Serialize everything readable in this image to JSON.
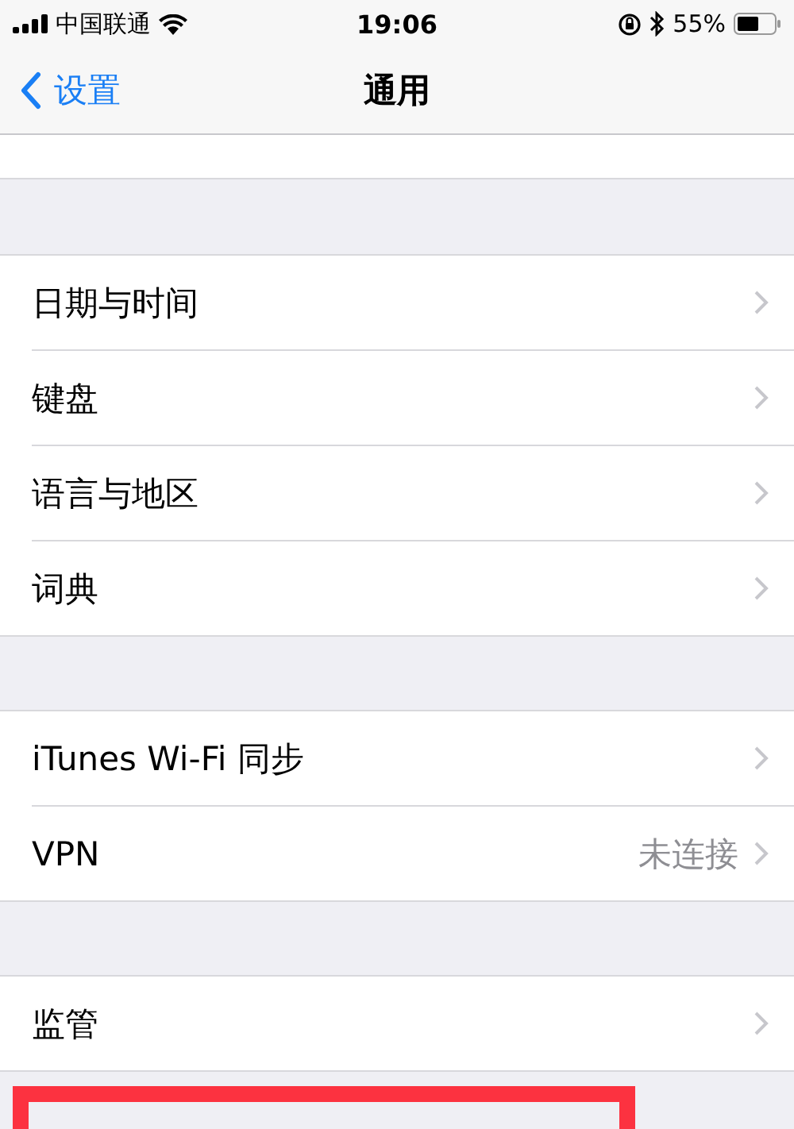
{
  "status_bar": {
    "carrier": "中国联通",
    "time": "19:06",
    "battery": "55%"
  },
  "nav": {
    "back": "设置",
    "title": "通用"
  },
  "groups": [
    {
      "rows": [
        {
          "label": "日期与时间"
        },
        {
          "label": "键盘"
        },
        {
          "label": "语言与地区"
        },
        {
          "label": "词典"
        }
      ]
    },
    {
      "rows": [
        {
          "label": "iTunes Wi-Fi 同步"
        },
        {
          "label": "VPN",
          "value": "未连接"
        }
      ]
    },
    {
      "rows": [
        {
          "label": "监管"
        }
      ]
    }
  ]
}
